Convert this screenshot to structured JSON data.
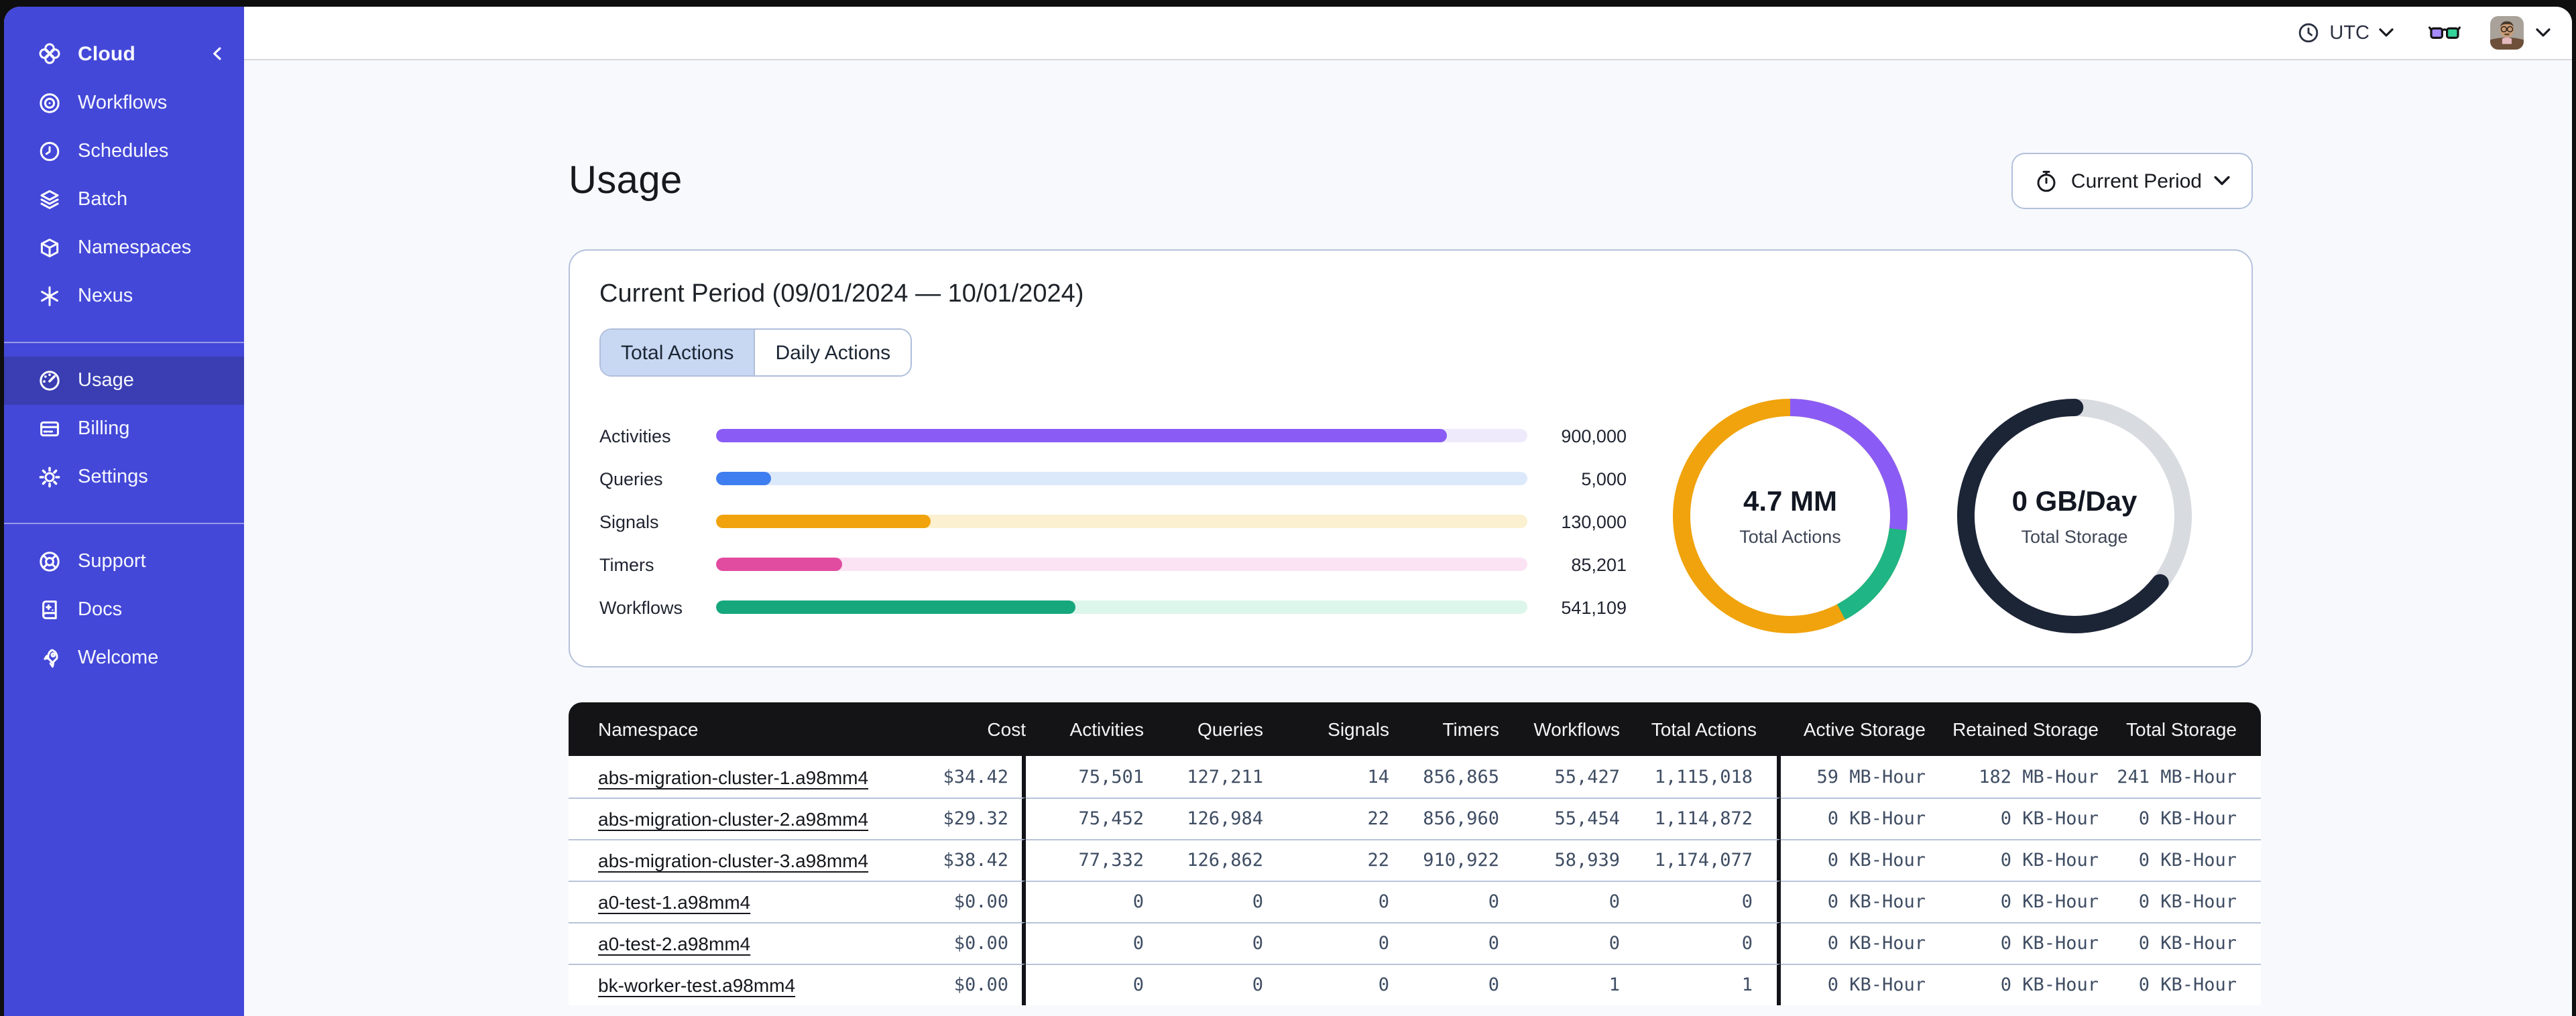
{
  "topbar": {
    "timezone_label": "UTC"
  },
  "sidebar": {
    "header_label": "Cloud",
    "groups": [
      {
        "items": [
          {
            "icon": "workflows",
            "label": "Workflows",
            "active": false
          },
          {
            "icon": "schedules",
            "label": "Schedules",
            "active": false
          },
          {
            "icon": "batch",
            "label": "Batch",
            "active": false
          },
          {
            "icon": "namespaces",
            "label": "Namespaces",
            "active": false
          },
          {
            "icon": "nexus",
            "label": "Nexus",
            "active": false
          }
        ]
      },
      {
        "items": [
          {
            "icon": "usage",
            "label": "Usage",
            "active": true
          },
          {
            "icon": "billing",
            "label": "Billing",
            "active": false
          },
          {
            "icon": "settings",
            "label": "Settings",
            "active": false
          }
        ]
      },
      {
        "items": [
          {
            "icon": "support",
            "label": "Support",
            "active": false
          },
          {
            "icon": "docs",
            "label": "Docs",
            "active": false
          },
          {
            "icon": "welcome",
            "label": "Welcome",
            "active": false
          }
        ]
      }
    ]
  },
  "page": {
    "title": "Usage",
    "period_button_label": "Current Period"
  },
  "card": {
    "title": "Current Period (09/01/2024 — 10/01/2024)",
    "tabs": [
      {
        "label": "Total Actions",
        "active": true
      },
      {
        "label": "Daily Actions",
        "active": false
      }
    ]
  },
  "chart_data": [
    {
      "type": "bar",
      "title": "Actions by type (current period)",
      "categories": [
        "Activities",
        "Queries",
        "Signals",
        "Timers",
        "Workflows"
      ],
      "values": [
        900000,
        5000,
        130000,
        85201,
        541109
      ],
      "value_labels": [
        "900,000",
        "5,000",
        "130,000",
        "85,201",
        "541,109"
      ],
      "fill_fractions": [
        0.9,
        0.068,
        0.264,
        0.155,
        0.443
      ],
      "colors": [
        "#8A5CF5",
        "#3F7EF0",
        "#F0A30C",
        "#E14BA0",
        "#16A77C"
      ],
      "track_colors": [
        "#EFEAFB",
        "#DCE9FB",
        "#FBF0CF",
        "#FBE3F4",
        "#DDF6EC"
      ]
    },
    {
      "type": "pie",
      "title": "Total Actions donut",
      "center_value": "4.7 MM",
      "center_label": "Total Actions",
      "segments": [
        {
          "name": "purple",
          "percent": 26.9,
          "color": "#8A5CF5"
        },
        {
          "name": "green",
          "percent": 15.3,
          "color": "#1FB584"
        },
        {
          "name": "orange",
          "percent": 57.8,
          "color": "#F0A30C"
        }
      ],
      "render": {
        "base_color": "#F0A30C",
        "arcs": [
          {
            "color": "#8A5CF5",
            "start_deg": 0,
            "sweep_deg": 97,
            "cap": "butt"
          },
          {
            "color": "#1FB584",
            "start_deg": 97,
            "sweep_deg": 55,
            "cap": "butt"
          }
        ]
      }
    },
    {
      "type": "pie",
      "title": "Total Storage donut",
      "center_value": "0 GB/Day",
      "center_label": "Total Storage",
      "segments": [
        {
          "name": "dark",
          "percent": 64.4,
          "color": "#1C2536"
        },
        {
          "name": "gray",
          "percent": 35.6,
          "color": "#D8DBDF"
        }
      ],
      "render": {
        "base_color": "#D8DBDF",
        "arcs": [
          {
            "color": "#1C2536",
            "start_deg": 128,
            "sweep_deg": 232,
            "cap": "round"
          }
        ]
      }
    }
  ],
  "table": {
    "columns": [
      "Namespace",
      "Cost",
      "Activities",
      "Queries",
      "Signals",
      "Timers",
      "Workflows",
      "Total Actions",
      "Active Storage",
      "Retained Storage",
      "Total Storage"
    ],
    "rows": [
      {
        "namespace": "abs-migration-cluster-1.a98mm4",
        "cost": "$34.42",
        "activities": "75,501",
        "queries": "127,211",
        "signals": "14",
        "timers": "856,865",
        "workflows": "55,427",
        "total_actions": "1,115,018",
        "active_storage": "59 MB-Hour",
        "retained_storage": "182 MB-Hour",
        "total_storage": "241 MB-Hour"
      },
      {
        "namespace": "abs-migration-cluster-2.a98mm4",
        "cost": "$29.32",
        "activities": "75,452",
        "queries": "126,984",
        "signals": "22",
        "timers": "856,960",
        "workflows": "55,454",
        "total_actions": "1,114,872",
        "active_storage": "0 KB-Hour",
        "retained_storage": "0 KB-Hour",
        "total_storage": "0 KB-Hour"
      },
      {
        "namespace": "abs-migration-cluster-3.a98mm4",
        "cost": "$38.42",
        "activities": "77,332",
        "queries": "126,862",
        "signals": "22",
        "timers": "910,922",
        "workflows": "58,939",
        "total_actions": "1,174,077",
        "active_storage": "0 KB-Hour",
        "retained_storage": "0 KB-Hour",
        "total_storage": "0 KB-Hour"
      },
      {
        "namespace": "a0-test-1.a98mm4",
        "cost": "$0.00",
        "activities": "0",
        "queries": "0",
        "signals": "0",
        "timers": "0",
        "workflows": "0",
        "total_actions": "0",
        "active_storage": "0 KB-Hour",
        "retained_storage": "0 KB-Hour",
        "total_storage": "0 KB-Hour"
      },
      {
        "namespace": "a0-test-2.a98mm4",
        "cost": "$0.00",
        "activities": "0",
        "queries": "0",
        "signals": "0",
        "timers": "0",
        "workflows": "0",
        "total_actions": "0",
        "active_storage": "0 KB-Hour",
        "retained_storage": "0 KB-Hour",
        "total_storage": "0 KB-Hour"
      },
      {
        "namespace": "bk-worker-test.a98mm4",
        "cost": "$0.00",
        "activities": "0",
        "queries": "0",
        "signals": "0",
        "timers": "0",
        "workflows": "1",
        "total_actions": "1",
        "active_storage": "0 KB-Hour",
        "retained_storage": "0 KB-Hour",
        "total_storage": "0 KB-Hour"
      }
    ]
  },
  "colors": {
    "sidebar_bg": "#4448D8",
    "sidebar_active_bg": "#3A3EB2",
    "content_bg": "#F7F9FC",
    "card_border": "#B6C2DC",
    "table_header_bg": "#141416",
    "accent_tab_bg": "#C8D8F2",
    "glasses_left_lens": "#A78BFA",
    "glasses_right_lens": "#34D399"
  }
}
